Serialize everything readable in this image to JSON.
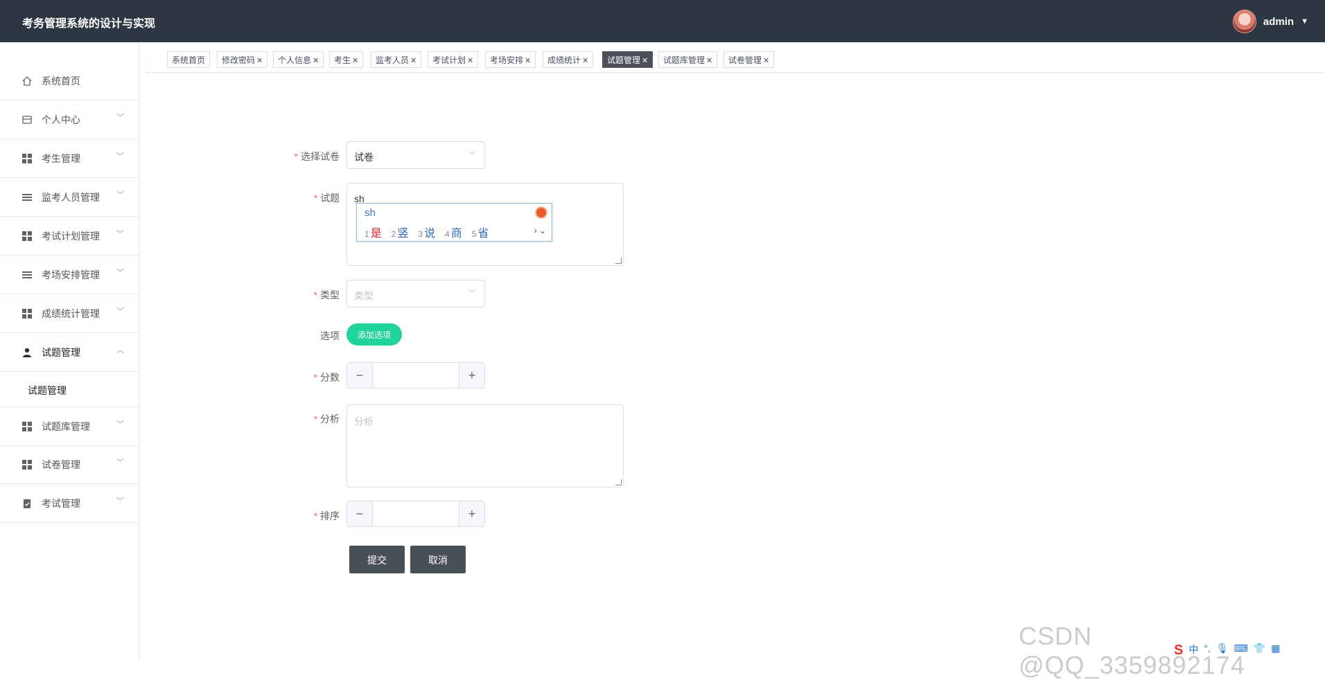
{
  "header": {
    "app_title": "考务管理系统的设计与实现",
    "username": "admin"
  },
  "sidebar": {
    "items": [
      {
        "label": "系统首页",
        "icon": "home-icon"
      },
      {
        "label": "个人中心",
        "icon": "card-icon"
      },
      {
        "label": "考生管理",
        "icon": "grid-icon"
      },
      {
        "label": "监考人员管理",
        "icon": "list-icon"
      },
      {
        "label": "考试计划管理",
        "icon": "grid-icon"
      },
      {
        "label": "考场安排管理",
        "icon": "list-icon"
      },
      {
        "label": "成绩统计管理",
        "icon": "grid-icon"
      },
      {
        "label": "试题管理",
        "icon": "user-icon"
      },
      {
        "label": "试题库管理",
        "icon": "grid-icon"
      },
      {
        "label": "试卷管理",
        "icon": "grid-icon"
      },
      {
        "label": "考试管理",
        "icon": "clipboard-icon"
      }
    ],
    "sub_item": "试题管理"
  },
  "tabs": [
    {
      "label": "系统首页",
      "closable": false
    },
    {
      "label": "修改密码",
      "closable": true
    },
    {
      "label": "个人信息",
      "closable": true
    },
    {
      "label": "考生",
      "closable": true
    },
    {
      "label": "监考人员",
      "closable": true
    },
    {
      "label": "考试计划",
      "closable": true
    },
    {
      "label": "考场安排",
      "closable": true
    },
    {
      "label": "成绩统计",
      "closable": true
    },
    {
      "label": "试题管理",
      "closable": true,
      "active": true
    },
    {
      "label": "试题库管理",
      "closable": true
    },
    {
      "label": "试卷管理",
      "closable": true
    }
  ],
  "form": {
    "paper_label": "选择试卷",
    "paper_value": "试卷",
    "question_label": "试题",
    "question_value": "sh",
    "type_label": "类型",
    "type_placeholder": "类型",
    "options_label": "选项",
    "add_option_button": "添加选项",
    "score_label": "分数",
    "analysis_label": "分析",
    "analysis_placeholder": "分析",
    "order_label": "排序",
    "submit_button": "提交",
    "cancel_button": "取消",
    "required_mark": "*"
  },
  "ime": {
    "pinyin": "sh",
    "candidates": [
      {
        "n": "1",
        "text": "是"
      },
      {
        "n": "2",
        "text": "竖"
      },
      {
        "n": "3",
        "text": "说"
      },
      {
        "n": "4",
        "text": "商"
      },
      {
        "n": "5",
        "text": "省"
      }
    ],
    "more": "› ⌄"
  },
  "watermark": "CSDN @QQ_3359892174",
  "tray": {
    "ime_logo": "S",
    "ime_mode": "中",
    "punct": "°,"
  },
  "colors": {
    "header_bg": "#2d3742",
    "active_tab": "#4a5057",
    "add_option": "#1fd39a",
    "required": "#f56c6c"
  }
}
